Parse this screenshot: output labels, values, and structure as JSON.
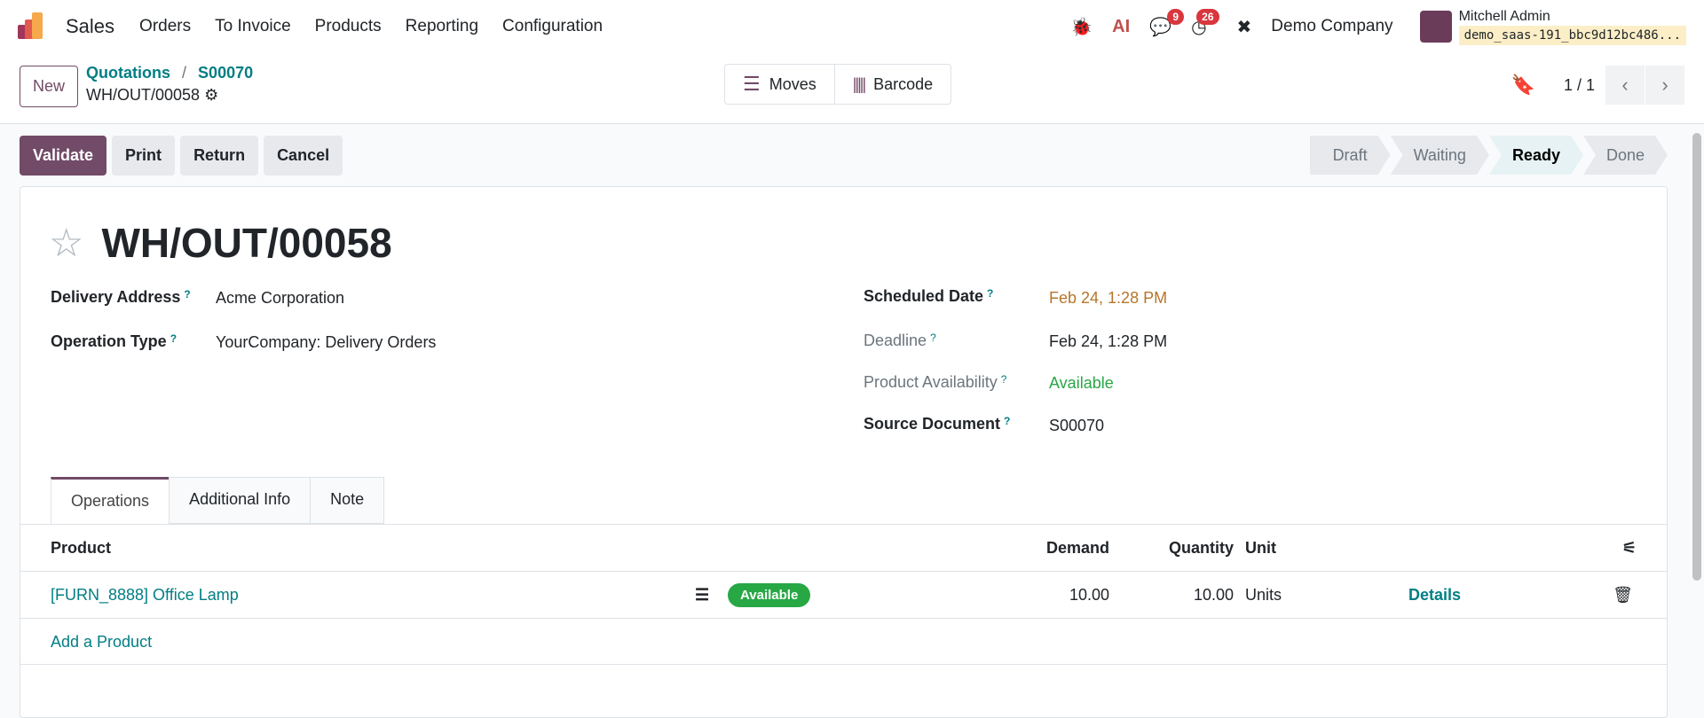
{
  "nav": {
    "app": "Sales",
    "menus": [
      "Orders",
      "To Invoice",
      "Products",
      "Reporting",
      "Configuration"
    ],
    "ai": "AI",
    "messages_count": "9",
    "activities_count": "26",
    "company": "Demo Company",
    "user": "Mitchell Admin",
    "database": "demo_saas-191_bbc9d12bc486..."
  },
  "cp": {
    "new": "New",
    "breadcrumb": [
      "Quotations",
      "S00070"
    ],
    "current": "WH/OUT/00058",
    "moves": "Moves",
    "barcode": "Barcode",
    "pager": "1 / 1"
  },
  "actions": [
    "Validate",
    "Print",
    "Return",
    "Cancel"
  ],
  "status": [
    "Draft",
    "Waiting",
    "Ready",
    "Done"
  ],
  "form": {
    "title": "WH/OUT/00058",
    "delivery_address_label": "Delivery Address",
    "delivery_address": "Acme Corporation",
    "operation_type_label": "Operation Type",
    "operation_type": "YourCompany: Delivery Orders",
    "scheduled_date_label": "Scheduled Date",
    "scheduled_date": "Feb 24, 1:28 PM",
    "deadline_label": "Deadline",
    "deadline": "Feb 24, 1:28 PM",
    "availability_label": "Product Availability",
    "availability": "Available",
    "source_label": "Source Document",
    "source": "S00070",
    "help": "?"
  },
  "tabs": [
    "Operations",
    "Additional Info",
    "Note"
  ],
  "table": {
    "headers": {
      "product": "Product",
      "demand": "Demand",
      "quantity": "Quantity",
      "unit": "Unit"
    },
    "rows": [
      {
        "product": "[FURN_8888] Office Lamp",
        "status": "Available",
        "demand": "10.00",
        "quantity": "10.00",
        "unit": "Units",
        "details": "Details"
      }
    ],
    "add": "Add a Product"
  },
  "colors": {
    "brand": "#714b67",
    "link": "#017e84",
    "warn": "#b7752b",
    "ok": "#28a745"
  }
}
